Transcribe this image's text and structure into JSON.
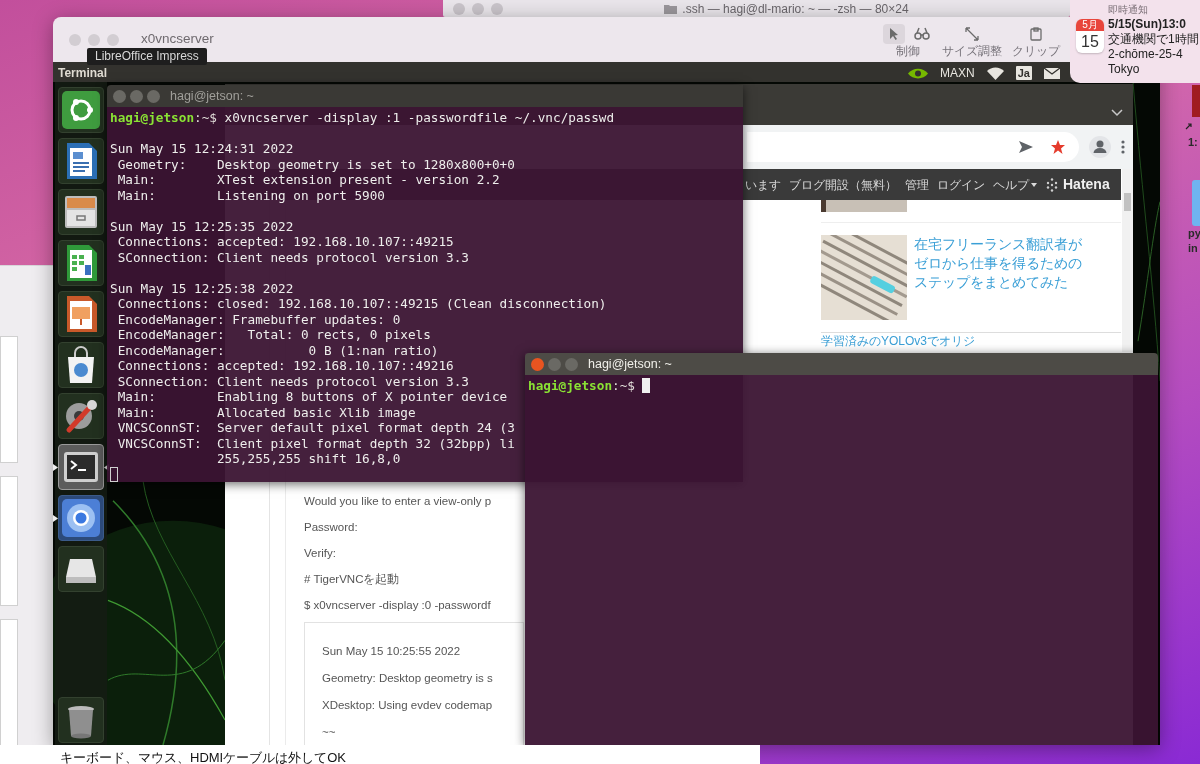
{
  "mac_back_window": {
    "title": ".ssh — hagi@dl-mario: ~ — -zsh — 80×24"
  },
  "notification": {
    "header": "即時通知",
    "calendar_month": "5月",
    "calendar_day": "15",
    "lines": [
      "5/15(Sun)13:0",
      "交通機関で1時間",
      "2-chōme-25-4",
      "Tokyo"
    ]
  },
  "vnc_window": {
    "title": "x0vncserver",
    "toolbar": [
      {
        "kind": "control",
        "label": "制御",
        "selected": true
      },
      {
        "kind": "resize",
        "label": "サイズ調整",
        "selected": false
      },
      {
        "kind": "clipboard",
        "label": "クリップ",
        "selected": false
      }
    ]
  },
  "tooltip": "LibreOffice Impress",
  "ubuntu_panel": {
    "app_name": "Terminal",
    "power_mode": "MAXN",
    "input_method": "Ja"
  },
  "launcher": [
    {
      "kind": "ubuntu",
      "running": false,
      "focused": false
    },
    {
      "kind": "writer",
      "running": false,
      "focused": false
    },
    {
      "kind": "files",
      "running": false,
      "focused": false
    },
    {
      "kind": "calc",
      "running": false,
      "focused": false
    },
    {
      "kind": "impress",
      "running": false,
      "focused": false
    },
    {
      "kind": "software",
      "running": false,
      "focused": false
    },
    {
      "kind": "settings",
      "running": false,
      "focused": false
    },
    {
      "kind": "terminal",
      "running": true,
      "focused": true
    },
    {
      "kind": "chromium",
      "running": true,
      "focused": false
    },
    {
      "kind": "drive",
      "running": false,
      "focused": false
    },
    {
      "kind": "trash",
      "running": false,
      "focused": false
    }
  ],
  "browser": {
    "hatena_menu": [
      {
        "label": "います",
        "dropdown": false
      },
      {
        "label": "ブログ開設（無料）",
        "dropdown": false
      },
      {
        "label": "管理",
        "dropdown": false
      },
      {
        "label": "ログイン",
        "dropdown": false
      },
      {
        "label": "ヘルプ",
        "dropdown": true
      }
    ],
    "brand": "Hatena",
    "sidebar_articles": [
      {
        "title": "在宅フリーランス翻訳者がゼロから仕事を得るためのステップをまとめてみた"
      },
      {
        "title": "学習済みのYOLOv3でオリジ"
      }
    ],
    "post_lines": [
      "Would you like to enter a view-only p",
      "Password:",
      "Verify:",
      "# TigerVNCを起動",
      "$ x0vncserver -display :0 -passwordf"
    ],
    "code_lines": [
      "Sun May 15 10:25:55 2022",
      "Geometry: Desktop geometry is s",
      "XDesktop: Using evdev codemap",
      "~~"
    ]
  },
  "terminals": [
    {
      "title": "hagi@jetson: ~",
      "focused": false,
      "blocks": [
        {
          "lines": [
            {
              "kind": "prompt",
              "user": "hagi@jetson",
              "path": ":~$",
              "command": "x0vncserver -display :1 -passwordfile ~/.vnc/passwd"
            }
          ]
        },
        {
          "lines": [
            {
              "kind": "output",
              "text": "Sun May 15 12:24:31 2022"
            },
            {
              "kind": "output",
              "text": " Geometry:    Desktop geometry is set to 1280x800+0+0"
            },
            {
              "kind": "output",
              "text": " Main:        XTest extension present - version 2.2"
            },
            {
              "kind": "output",
              "text": " Main:        Listening on port 5900"
            }
          ]
        },
        {
          "lines": [
            {
              "kind": "output",
              "text": "Sun May 15 12:25:35 2022"
            },
            {
              "kind": "output",
              "text": " Connections: accepted: 192.168.10.107::49215"
            },
            {
              "kind": "output",
              "text": " SConnection: Client needs protocol version 3.3"
            }
          ]
        },
        {
          "lines": [
            {
              "kind": "output",
              "text": "Sun May 15 12:25:38 2022"
            },
            {
              "kind": "output",
              "text": " Connections: closed: 192.168.10.107::49215 (Clean disconnection)"
            },
            {
              "kind": "output",
              "text": " EncodeManager: Framebuffer updates: 0"
            },
            {
              "kind": "output",
              "text": " EncodeManager:   Total: 0 rects, 0 pixels"
            },
            {
              "kind": "output",
              "text": " EncodeManager:           0 B (1:nan ratio)"
            },
            {
              "kind": "output",
              "text": " Connections: accepted: 192.168.10.107::49216"
            },
            {
              "kind": "output",
              "text": " SConnection: Client needs protocol version 3.3"
            },
            {
              "kind": "output",
              "text": " Main:        Enabling 8 buttons of X pointer device"
            },
            {
              "kind": "output",
              "text": " Main:        Allocated basic Xlib image"
            },
            {
              "kind": "output",
              "text": " VNCSConnST:  Server default pixel format depth 24 (3"
            },
            {
              "kind": "output",
              "text": " VNCSConnST:  Client pixel format depth 32 (32bpp) li"
            },
            {
              "kind": "output",
              "text": "              255,255,255 shift 16,8,0"
            }
          ]
        }
      ]
    },
    {
      "title": "hagi@jetson: ~",
      "focused": true,
      "blocks": [
        {
          "lines": [
            {
              "kind": "prompt",
              "user": "hagi@jetson",
              "path": ":~$"
            }
          ]
        }
      ]
    }
  ],
  "impress_caption": "キーボード、マウス、HDMIケーブルは外してOK",
  "desktop_icons": [
    {
      "kind": "document",
      "lines": [
        "1:"
      ]
    },
    {
      "kind": "folder",
      "lines": [
        "py",
        "in"
      ]
    }
  ]
}
